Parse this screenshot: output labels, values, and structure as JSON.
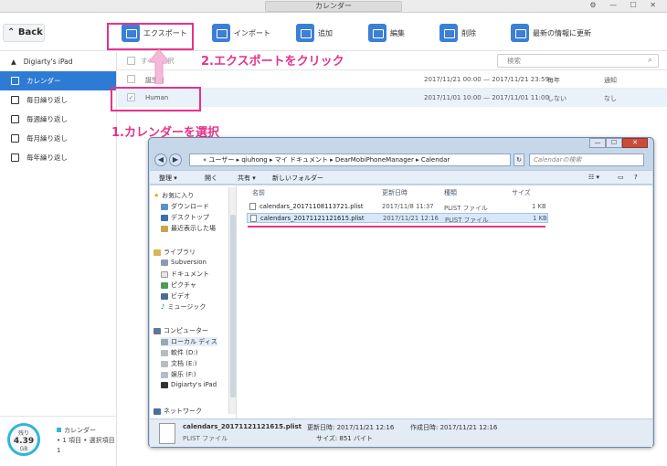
{
  "window": {
    "title": "カレンダー",
    "controls": "⚙ — ☐ ✕"
  },
  "toolbar": {
    "back_label": "Back",
    "items": [
      {
        "label": "エクスポート",
        "icon": "export-icon"
      },
      {
        "label": "インポート",
        "icon": "import-icon"
      },
      {
        "label": "追加",
        "icon": "add-icon"
      },
      {
        "label": "編集",
        "icon": "edit-icon"
      },
      {
        "label": "削除",
        "icon": "trash-icon"
      },
      {
        "label": "最新の情報に更新",
        "icon": "refresh-icon"
      }
    ]
  },
  "annotations": {
    "step1": "1.カレンダーを選択",
    "step2": "2.エクスポートをクリック",
    "highlight_color": "#e8318a"
  },
  "sidebar": {
    "items": [
      {
        "label": "Digiarty's iPad",
        "icon": "device-icon"
      },
      {
        "label": "カレンダー",
        "icon": "calendar-icon"
      },
      {
        "label": "毎日繰り返し",
        "icon": "repeat-daily-icon"
      },
      {
        "label": "毎週繰り返し",
        "icon": "repeat-weekly-icon"
      },
      {
        "label": "毎月繰り返し",
        "icon": "repeat-monthly-icon"
      },
      {
        "label": "毎年繰り返し",
        "icon": "repeat-yearly-icon"
      }
    ],
    "active_index": 1,
    "storage": {
      "label": "残り",
      "value": "4.39",
      "unit": "GB"
    },
    "legend": {
      "title": "カレンダー",
      "count": "1 項目",
      "selected": "選択項目 1"
    }
  },
  "list": {
    "select_all": "すべて選択",
    "search_placeholder": "検索",
    "rows": [
      {
        "name": "誕生日",
        "time": "2017/11/21 00:00 — 2017/11/21 23:59",
        "repeat": "毎年",
        "alert": "通知",
        "checked": "",
        "selected": false
      },
      {
        "name": "Human",
        "time": "2017/11/01 10:00 — 2017/11/01 11:00",
        "repeat": "しない",
        "alert": "なし",
        "checked": "✓",
        "selected": true
      }
    ]
  },
  "explorer": {
    "address": "« ユーザー ▸ qiuhong ▸ マイ ドキュメント ▸ DearMobiPhoneManager ▸ Calendar",
    "search_placeholder": "Calendarの検索",
    "commands": {
      "organize": "整理 ▾",
      "open": "開く",
      "share": "共有 ▾",
      "new_folder": "新しいフォルダー"
    },
    "columns": {
      "name": "名前",
      "date": "更新日時",
      "type": "種類",
      "size": "サイズ"
    },
    "nav": {
      "favorites": "お気に入り",
      "downloads": "ダウンロード",
      "desktop": "デスクトップ",
      "recent": "最近表示した場",
      "libraries": "ライブラリ",
      "subversion": "Subversion",
      "documents": "ドキュメント",
      "pictures": "ピクチャ",
      "videos": "ビデオ",
      "music": "ミュージック",
      "computer": "コンピューター",
      "local_disk": "ローカル ディス",
      "drive_d": "軟件 (D:)",
      "drive_e": "文档 (E:)",
      "drive_f": "娱乐 (F:)",
      "ipad": "Digiarty's iPad",
      "network": "ネットワーク"
    },
    "files": [
      {
        "name": "calendars_20171108113721.plist",
        "date": "2017/11/8 11:37",
        "type": "PLIST ファイル",
        "size": "1 KB",
        "selected": false
      },
      {
        "name": "calendars_20171121121615.plist",
        "date": "2017/11/21 12:16",
        "type": "PLIST ファイル",
        "size": "1 KB",
        "selected": true
      }
    ],
    "status": {
      "filename": "calendars_20171121121615.plist",
      "filetype": "PLIST ファイル",
      "modified": "更新日時: 2017/11/21 12:16",
      "created": "作成日時: 2017/11/21 12:16",
      "size": "サイズ: 851 バイト"
    }
  }
}
